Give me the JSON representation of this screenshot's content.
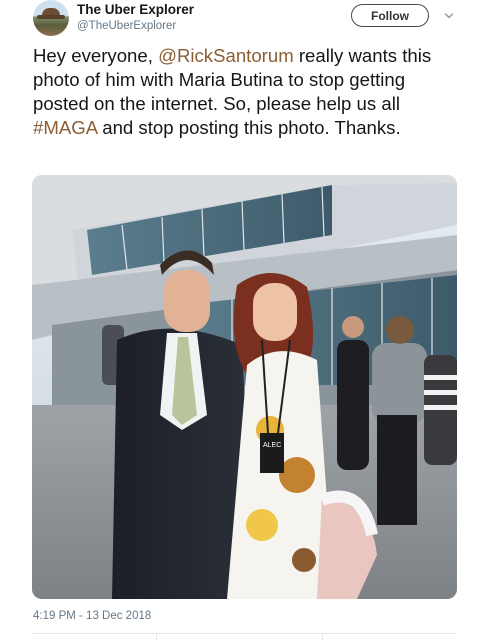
{
  "author": {
    "display_name": "The Uber Explorer",
    "handle": "@TheUberExplorer"
  },
  "follow_button": {
    "label": "Follow"
  },
  "menu": {
    "icon": "chevron-down-icon"
  },
  "tweet": {
    "text_parts": [
      {
        "type": "text",
        "value": "Hey everyone, "
      },
      {
        "type": "mention",
        "value": "@RickSantorum"
      },
      {
        "type": "text",
        "value": " really wants this photo of him with Maria Butina to stop getting posted on the internet. So, please help us all "
      },
      {
        "type": "hashtag",
        "value": "#MAGA"
      },
      {
        "type": "text",
        "value": " and stop posting this photo. Thanks."
      }
    ],
    "timestamp": "4:19 PM - 13 Dec 2018"
  },
  "photo": {
    "badge_text": "ALEC"
  },
  "colors": {
    "link": "#8b5e34",
    "muted": "#657786",
    "divider": "#e1e8ed"
  }
}
